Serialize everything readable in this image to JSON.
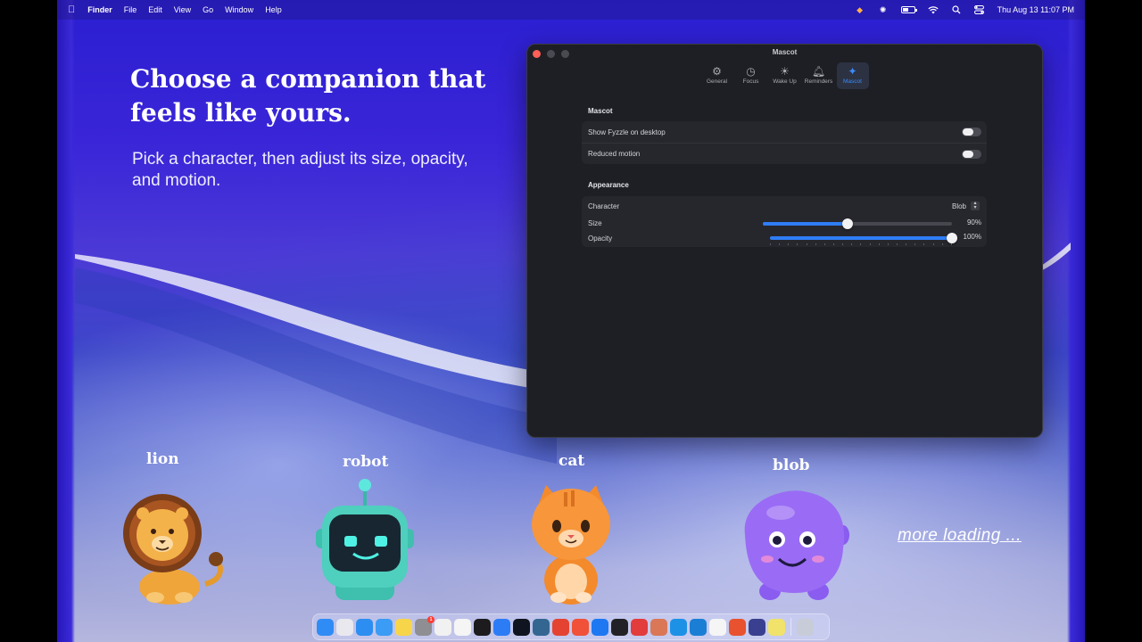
{
  "menubar": {
    "apple": "",
    "items": [
      "Finder",
      "File",
      "Edit",
      "View",
      "Go",
      "Window",
      "Help"
    ],
    "clock": "Thu Aug 13  11:07 PM"
  },
  "hero": {
    "headline": "Choose a companion that feels like yours.",
    "subline": "Pick a character, then adjust its size, opacity, and motion."
  },
  "window": {
    "title": "Mascot",
    "tabs": [
      {
        "label": "General",
        "icon": "gear-icon",
        "glyph": "⚙"
      },
      {
        "label": "Focus",
        "icon": "timer-icon",
        "glyph": "◷"
      },
      {
        "label": "Wake Up",
        "icon": "sun-icon",
        "glyph": "☀"
      },
      {
        "label": "Reminders",
        "icon": "bell-icon",
        "glyph": "🔔︎"
      },
      {
        "label": "Mascot",
        "icon": "sparkle-icon",
        "glyph": "✦"
      }
    ],
    "active_tab": "Mascot",
    "mascot_section": {
      "title": "Mascot",
      "show_on_desktop_label": "Show Fyzzle on desktop",
      "reduced_motion_label": "Reduced motion"
    },
    "appearance_section": {
      "title": "Appearance",
      "character_label": "Character",
      "character_value": "Blob",
      "size_label": "Size",
      "size_value": "90%",
      "size_fraction": 0.45,
      "opacity_label": "Opacity",
      "opacity_value": "100%",
      "opacity_fraction": 1.0
    }
  },
  "characters": [
    {
      "name": "lion"
    },
    {
      "name": "robot"
    },
    {
      "name": "cat"
    },
    {
      "name": "blob"
    }
  ],
  "more_text": "more loading ...",
  "dock": {
    "apps": [
      {
        "icon": "finder-icon",
        "color": "#2f8cf5"
      },
      {
        "icon": "launchpad-icon",
        "color": "#e8e8ee"
      },
      {
        "icon": "safari-icon",
        "color": "#2c8ef0"
      },
      {
        "icon": "mail-icon",
        "color": "#3a9cf5"
      },
      {
        "icon": "notes-icon",
        "color": "#f7d54a"
      },
      {
        "icon": "settings-icon",
        "color": "#8e8e93",
        "badge": "1"
      },
      {
        "icon": "chrome-icon",
        "color": "#f1f1f1"
      },
      {
        "icon": "slack-icon",
        "color": "#f5f5f5"
      },
      {
        "icon": "terminal-icon",
        "color": "#1c1c1e"
      },
      {
        "icon": "appstore-icon",
        "color": "#2c7cf6"
      },
      {
        "icon": "webstorm-icon",
        "color": "#0f1420"
      },
      {
        "icon": "postgres-icon",
        "color": "#336791"
      },
      {
        "icon": "todoist-icon",
        "color": "#e44332"
      },
      {
        "icon": "swift-icon",
        "color": "#f05138"
      },
      {
        "icon": "xcode-icon",
        "color": "#1d78f2"
      },
      {
        "icon": "cube-icon",
        "color": "#222226"
      },
      {
        "icon": "lasso-icon",
        "color": "#e23c3c"
      },
      {
        "icon": "claude-icon",
        "color": "#d97757"
      },
      {
        "icon": "docker-icon",
        "color": "#1d91e6"
      },
      {
        "icon": "vscode-icon",
        "color": "#1a7fd4"
      },
      {
        "icon": "notion-icon",
        "color": "#f5f5f5"
      },
      {
        "icon": "word-icon",
        "color": "#e8522e"
      },
      {
        "icon": "fyzzle-icon",
        "color": "#3a3f8f"
      },
      {
        "icon": "preview-icon",
        "color": "#f0e26a"
      },
      {
        "icon": "trash-icon",
        "color": "#c8ccd8"
      }
    ]
  }
}
